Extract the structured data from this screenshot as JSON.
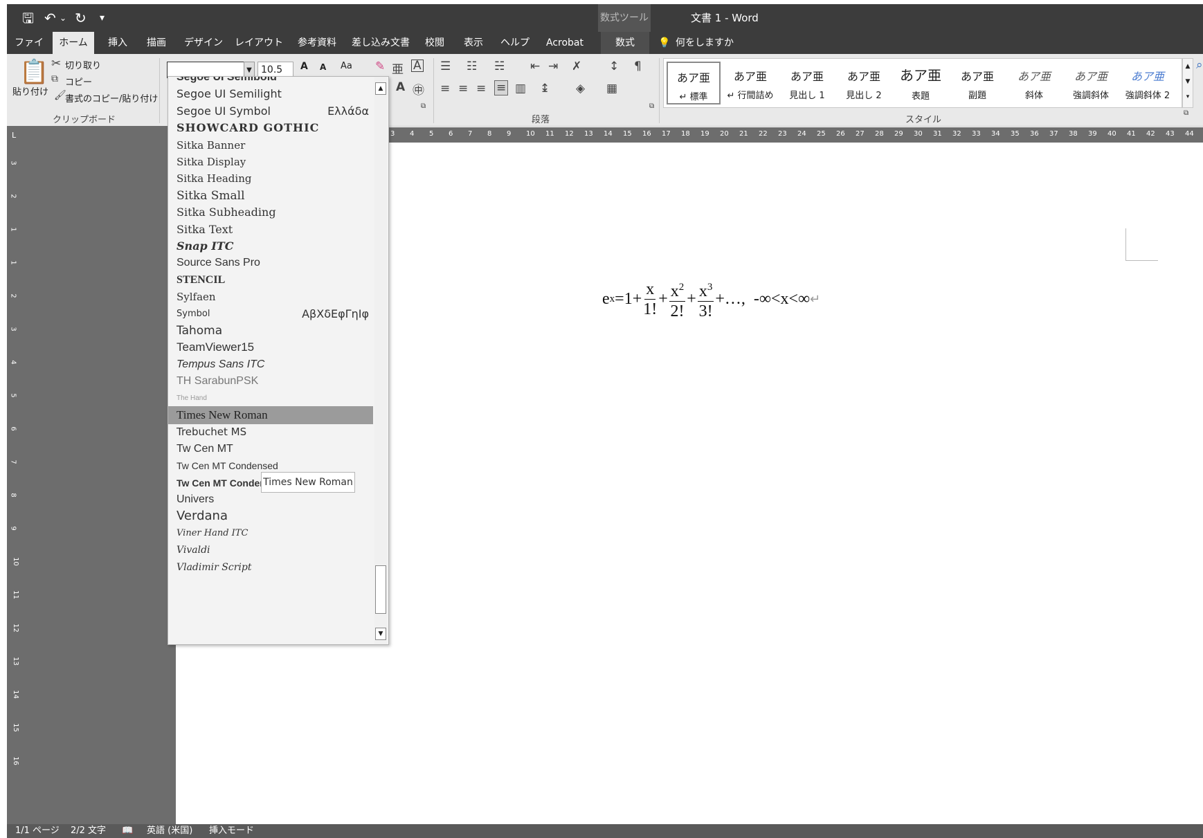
{
  "window": {
    "title": "文書 1  -  Word",
    "contextual_tab_group": "数式ツール"
  },
  "quick_access": {
    "save_icon": "save-icon",
    "undo_icon": "undo-icon",
    "redo_icon": "redo-icon",
    "customize_icon": "qat-customize-icon"
  },
  "tabs": [
    {
      "label": "ファイル"
    },
    {
      "label": "ホーム"
    },
    {
      "label": "挿入"
    },
    {
      "label": "描画"
    },
    {
      "label": "デザイン"
    },
    {
      "label": "レイアウト"
    },
    {
      "label": "参考資料"
    },
    {
      "label": "差し込み文書"
    },
    {
      "label": "校閲"
    },
    {
      "label": "表示"
    },
    {
      "label": "ヘルプ"
    },
    {
      "label": "Acrobat"
    },
    {
      "label": "数式"
    }
  ],
  "tell_me": "何をしますか",
  "clipboard": {
    "paste": "貼り付け",
    "cut": "切り取り",
    "copy": "コピー",
    "format_painter": "書式のコピー/貼り付け",
    "group_label": "クリップボード"
  },
  "font": {
    "name_value": "",
    "size_value": "10.5",
    "grow_label": "A",
    "shrink_label": "A",
    "case_label": "Aa"
  },
  "paragraph": {
    "group_label": "段落"
  },
  "styles": {
    "group_label": "スタイル",
    "items": [
      {
        "sample": "あア亜",
        "name": "↵ 標準"
      },
      {
        "sample": "あア亜",
        "name": "↵ 行間詰め"
      },
      {
        "sample": "あア亜",
        "name": "見出し 1"
      },
      {
        "sample": "あア亜",
        "name": "見出し 2"
      },
      {
        "sample": "あア亜",
        "name": "表題"
      },
      {
        "sample": "あア亜",
        "name": "副題"
      },
      {
        "sample": "あア亜",
        "name": "斜体"
      },
      {
        "sample": "あア亜",
        "name": "強調斜体"
      },
      {
        "sample": "あア亜",
        "name": "強調斜体 2"
      }
    ]
  },
  "font_list": {
    "items": [
      {
        "name": "Segoe UI Semibold",
        "sample": ""
      },
      {
        "name": "Segoe UI Semilight",
        "sample": ""
      },
      {
        "name": "Segoe UI Symbol",
        "sample": "Ελλάδα"
      },
      {
        "name": "SHOWCARD GOTHIC",
        "sample": ""
      },
      {
        "name": "Sitka Banner",
        "sample": ""
      },
      {
        "name": "Sitka Display",
        "sample": ""
      },
      {
        "name": "Sitka Heading",
        "sample": ""
      },
      {
        "name": "Sitka Small",
        "sample": ""
      },
      {
        "name": "Sitka Subheading",
        "sample": ""
      },
      {
        "name": "Sitka Text",
        "sample": ""
      },
      {
        "name": "Snap ITC",
        "sample": ""
      },
      {
        "name": "Source Sans Pro",
        "sample": ""
      },
      {
        "name": "STENCIL",
        "sample": ""
      },
      {
        "name": "Sylfaen",
        "sample": ""
      },
      {
        "name": "Symbol",
        "sample": "ΑβΧδΕφΓηΙφ"
      },
      {
        "name": "Tahoma",
        "sample": ""
      },
      {
        "name": "TeamViewer15",
        "sample": ""
      },
      {
        "name": "Tempus Sans ITC",
        "sample": ""
      },
      {
        "name": "TH SarabunPSK",
        "sample": ""
      },
      {
        "name": "The Hand",
        "sample": ""
      },
      {
        "name": "Times New Roman",
        "sample": ""
      },
      {
        "name": "Trebuchet MS",
        "sample": ""
      },
      {
        "name": "Tw Cen MT",
        "sample": ""
      },
      {
        "name": "Tw Cen MT Condensed",
        "sample": ""
      },
      {
        "name": "Tw Cen MT Condensed Extra Bold",
        "sample": ""
      },
      {
        "name": "Univers",
        "sample": ""
      },
      {
        "name": "Verdana",
        "sample": ""
      },
      {
        "name": "Viner Hand ITC",
        "sample": ""
      },
      {
        "name": "Vivaldi",
        "sample": ""
      },
      {
        "name": "Vladimir Script",
        "sample": ""
      }
    ],
    "highlighted": "Times New Roman",
    "tooltip": "Times New Roman"
  },
  "ruler": {
    "h_ticks": [
      "3",
      "4",
      "5",
      "6",
      "7",
      "8",
      "9",
      "10",
      "11",
      "12",
      "13",
      "14",
      "15",
      "16",
      "17",
      "18",
      "19",
      "20",
      "21",
      "22",
      "23",
      "24",
      "25",
      "26",
      "27",
      "28",
      "29",
      "30",
      "31",
      "32",
      "33",
      "34",
      "35",
      "36",
      "37",
      "38",
      "39",
      "40",
      "41",
      "42",
      "43",
      "44"
    ],
    "v_ticks": [
      "3",
      "2",
      "1",
      "1",
      "2",
      "3",
      "4",
      "5",
      "6",
      "7",
      "8",
      "9",
      "10",
      "11",
      "12",
      "13",
      "14",
      "15",
      "16"
    ]
  },
  "document": {
    "equation": {
      "lhs_base": "e",
      "lhs_exp": "x",
      "eq_one": "=1+",
      "frac1_num": "x",
      "frac1_den": "1!",
      "plus1": "+",
      "frac2_num": "x",
      "frac2_exp": "2",
      "frac2_den": "2!",
      "plus2": "+",
      "frac3_num": "x",
      "frac3_exp": "3",
      "frac3_den": "3!",
      "tail": "+…,  -∞<x<∞",
      "return_mark": "↵"
    }
  },
  "status": {
    "page": "1/1 ページ",
    "words": "2/2 文字",
    "language": "英語 (米国)",
    "mode": "挿入モード"
  },
  "colors": {
    "titlebar": "#3c3c3c",
    "ribbon": "#e9e9e9",
    "highlight": "#9b9b9b",
    "statusbar": "#5a5a5a"
  }
}
